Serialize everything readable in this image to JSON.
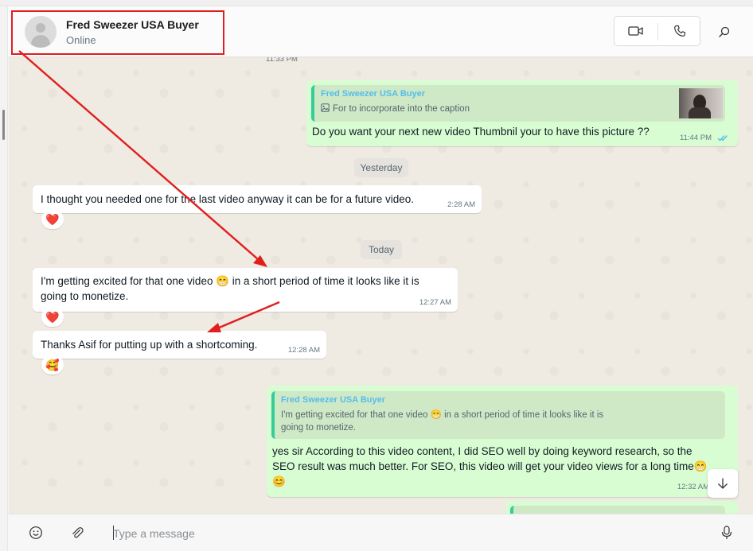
{
  "header": {
    "contact_name": "Fred Sweezer USA Buyer",
    "status": "Online"
  },
  "chat": {
    "partial_top_time": "11:33 PM",
    "msg1": {
      "quote_author": "Fred Sweezer USA Buyer",
      "quote_text": "For to incorporate into the caption",
      "text": "Do you want your next new video Thumbnil your to have this picture ??",
      "time": "11:44 PM"
    },
    "chip_yesterday": "Yesterday",
    "msg2": {
      "text": "I thought you needed one for the last video anyway it can be for a future video.",
      "time": "2:28 AM",
      "reaction": "❤️"
    },
    "chip_today": "Today",
    "msg3": {
      "text_line1": "I'm getting excited for that one video 😁 in a short period of time it looks like it is",
      "text_line2": "going to monetize.",
      "time": "12:27 AM",
      "reaction": "❤️"
    },
    "msg4": {
      "text": "Thanks Asif for putting up with a shortcoming.",
      "time": "12:28 AM",
      "reaction": "🥰"
    },
    "msg5": {
      "quote_author": "Fred Sweezer USA Buyer",
      "quote_line1": "I'm getting excited for that one video 😁 in a short period of time it looks like it is",
      "quote_line2": "going to monetize.",
      "text_line1": "yes sir According to this video content, I did SEO well by doing keyword research, so the",
      "text_line2": "SEO result was much better. For SEO, this video will get your video views for a long time😁",
      "text_line3": "😊",
      "time": "12:32 AM"
    }
  },
  "composer": {
    "placeholder": "Type a message"
  },
  "icons": {
    "video_call": "video-camera-icon",
    "voice_call": "phone-icon",
    "search": "search-icon",
    "emoji": "emoji-icon",
    "attach": "paperclip-icon",
    "mic": "microphone-icon",
    "scroll_down": "arrow-down-icon",
    "image": "image-icon"
  },
  "colors": {
    "outgoing_bubble": "#d9fdd3",
    "incoming_bubble": "#ffffff",
    "quote_author": "#53bdeb",
    "read_ticks": "#53bdeb",
    "annotation": "#e01e1e"
  }
}
